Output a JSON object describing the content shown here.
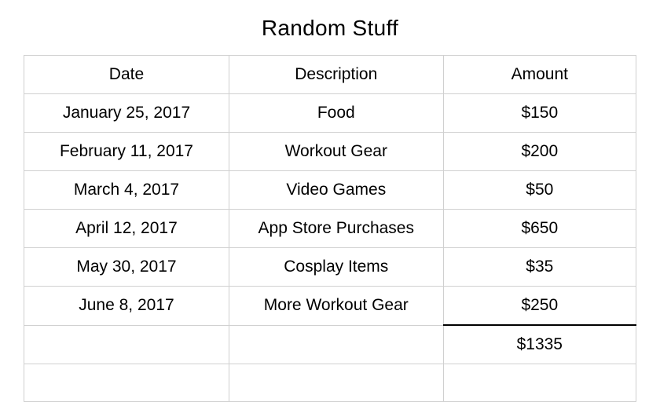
{
  "title": "Random Stuff",
  "columns": [
    "Date",
    "Description",
    "Amount"
  ],
  "rows": [
    {
      "date": "January 25, 2017",
      "description": "Food",
      "amount": "$150"
    },
    {
      "date": "February 11, 2017",
      "description": "Workout Gear",
      "amount": "$200"
    },
    {
      "date": "March 4, 2017",
      "description": "Video Games",
      "amount": "$50"
    },
    {
      "date": "April 12, 2017",
      "description": "App Store Purchases",
      "amount": "$650"
    },
    {
      "date": "May 30, 2017",
      "description": "Cosplay Items",
      "amount": "$35"
    },
    {
      "date": "June 8, 2017",
      "description": "More Workout Gear",
      "amount": "$250"
    }
  ],
  "total": "$1335",
  "chart_data": {
    "type": "table",
    "title": "Random Stuff",
    "columns": [
      "Date",
      "Description",
      "Amount"
    ],
    "rows": [
      [
        "January 25, 2017",
        "Food",
        150
      ],
      [
        "February 11, 2017",
        "Workout Gear",
        200
      ],
      [
        "March 4, 2017",
        "Video Games",
        50
      ],
      [
        "April 12, 2017",
        "App Store Purchases",
        650
      ],
      [
        "May 30, 2017",
        "Cosplay Items",
        35
      ],
      [
        "June 8, 2017",
        "More Workout Gear",
        250
      ]
    ],
    "total": 1335
  }
}
